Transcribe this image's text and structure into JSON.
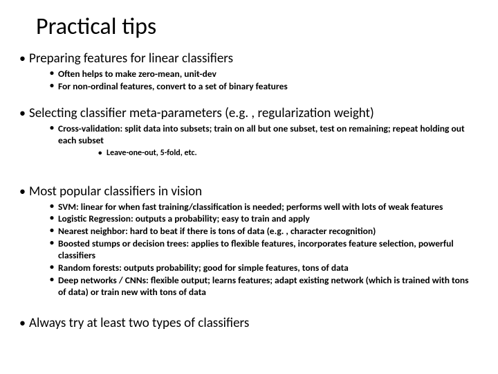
{
  "title": "Practical tips",
  "sections": [
    {
      "heading": "Preparing features for linear classifiers",
      "points": [
        "Often helps to make zero-mean, unit-dev",
        "For non-ordinal features, convert to a set of binary features"
      ]
    },
    {
      "heading": "Selecting classifier meta-parameters (e.g. , regularization weight)",
      "points": [
        "Cross-validation: split data into subsets; train on all but one subset, test on remaining; repeat holding out each subset"
      ],
      "subpoints": [
        "Leave-one-out, 5-fold, etc."
      ]
    },
    {
      "heading": "Most popular classifiers in vision",
      "points": [
        "SVM: linear for when fast training/classification is needed; performs well with lots of weak features",
        "Logistic Regression: outputs a probability; easy to train and apply",
        "Nearest neighbor: hard to beat if there is tons of data (e.g. , character recognition)",
        "Boosted stumps or decision trees: applies to flexible features, incorporates feature selection, powerful classifiers",
        "Random forests: outputs probability; good for simple features, tons of data",
        "Deep networks / CNNs: flexible output; learns features; adapt existing network (which is trained with tons of data) or train new with tons of data"
      ]
    },
    {
      "heading": "Always try at least two types of classifiers"
    }
  ]
}
